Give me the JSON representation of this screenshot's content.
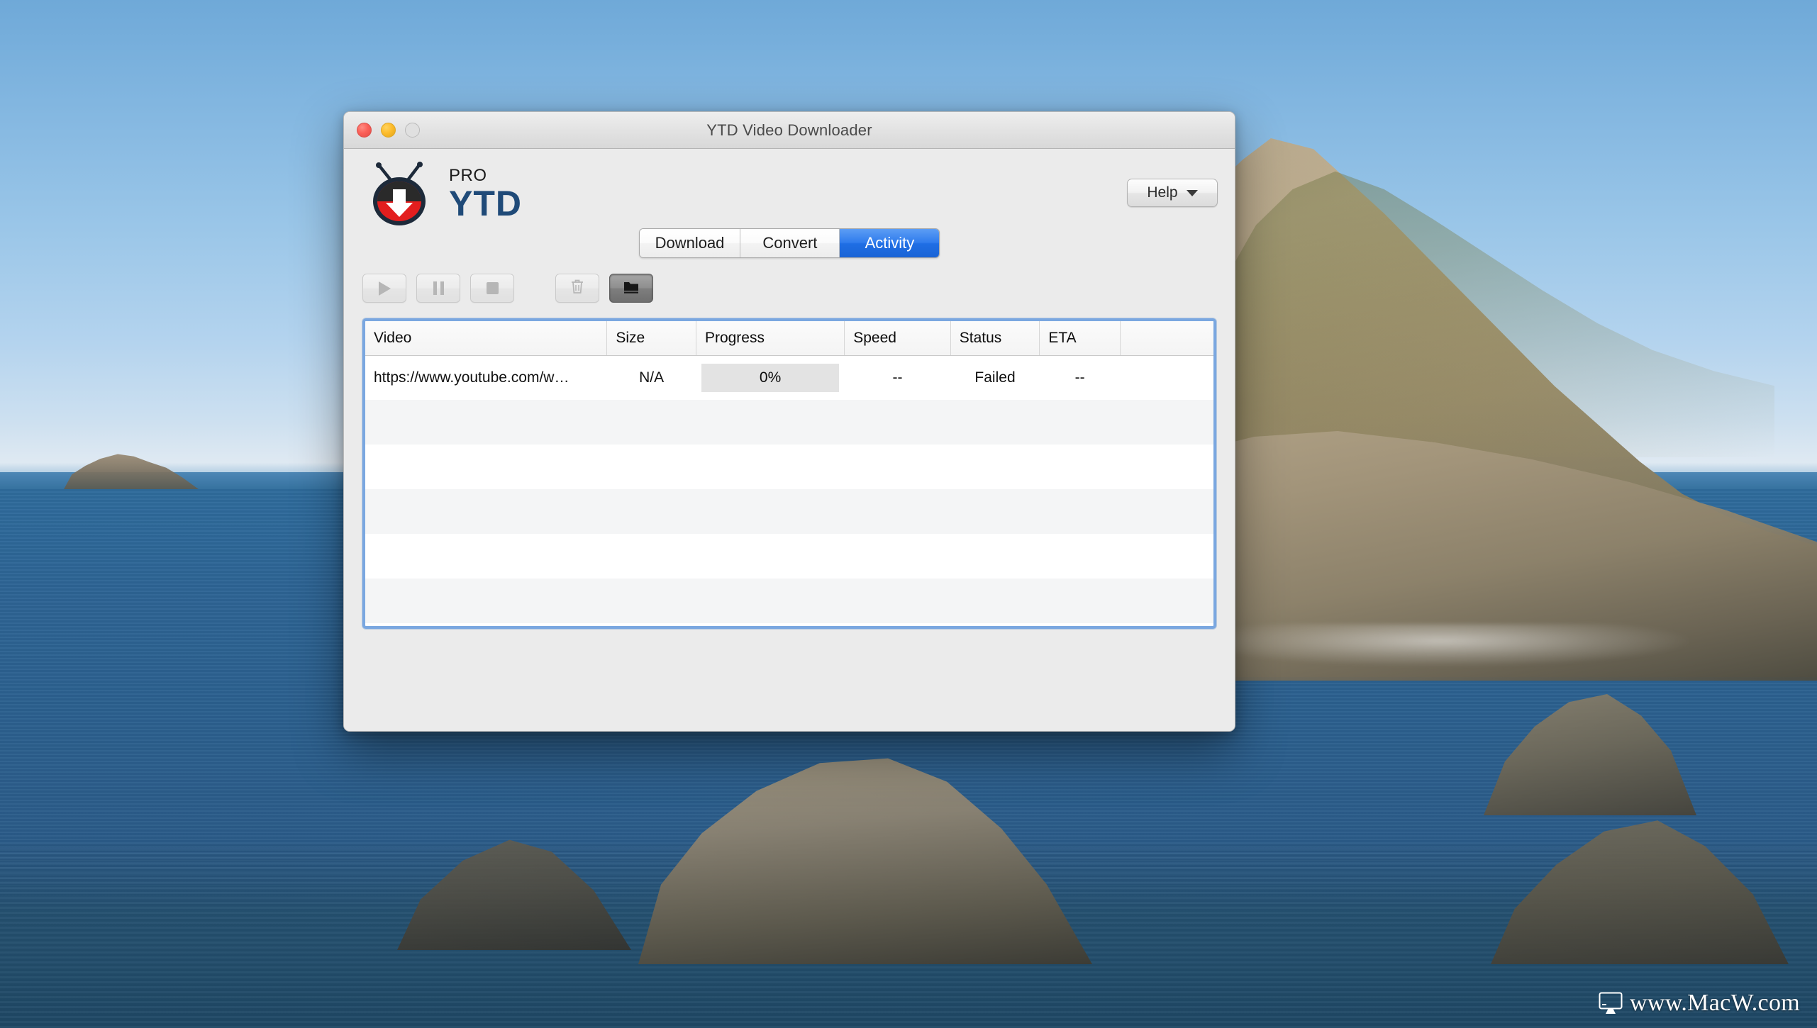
{
  "window": {
    "title": "YTD Video Downloader",
    "traffic_lights": [
      "close-button",
      "minimize-button",
      "zoom-button"
    ]
  },
  "brand": {
    "pro_label": "PRO",
    "name_label": "YTD",
    "logo_icon": "ytd-tv-download-logo",
    "brand_blue": "#1f4a78",
    "brand_red": "#e02020"
  },
  "header": {
    "help_label": "Help",
    "help_caret_icon": "chevron-down-icon"
  },
  "tabs": [
    {
      "label": "Download",
      "active": false,
      "name": "tab-download"
    },
    {
      "label": "Convert",
      "active": false,
      "name": "tab-convert"
    },
    {
      "label": "Activity",
      "active": true,
      "name": "tab-activity"
    }
  ],
  "toolbar": {
    "buttons": [
      {
        "name": "start-button",
        "icon": "play-icon",
        "enabled": false
      },
      {
        "name": "pause-button",
        "icon": "pause-icon",
        "enabled": false
      },
      {
        "name": "stop-button",
        "icon": "stop-icon",
        "enabled": false
      },
      {
        "name": "delete-button",
        "icon": "trash-icon",
        "enabled": false
      },
      {
        "name": "open-folder-button",
        "icon": "folder-icon",
        "enabled": true,
        "pressed": true
      }
    ]
  },
  "table": {
    "columns": [
      "Video",
      "Size",
      "Progress",
      "Speed",
      "Status",
      "ETA"
    ],
    "rows": [
      {
        "video": "https://www.youtube.com/w…",
        "size": "N/A",
        "progress": "0%",
        "progress_value": 0,
        "speed": "--",
        "status": "Failed",
        "eta": "--"
      }
    ],
    "empty_row_count": 5,
    "focus_ring_color": "#7aa7e0"
  },
  "watermark": {
    "text": "www.MacW.com",
    "icon": "monitor-icon"
  },
  "colors": {
    "accent_blue": "#2f7ced",
    "window_bg": "#ebebeb",
    "titlebar_bg": "#e3e3e3"
  }
}
